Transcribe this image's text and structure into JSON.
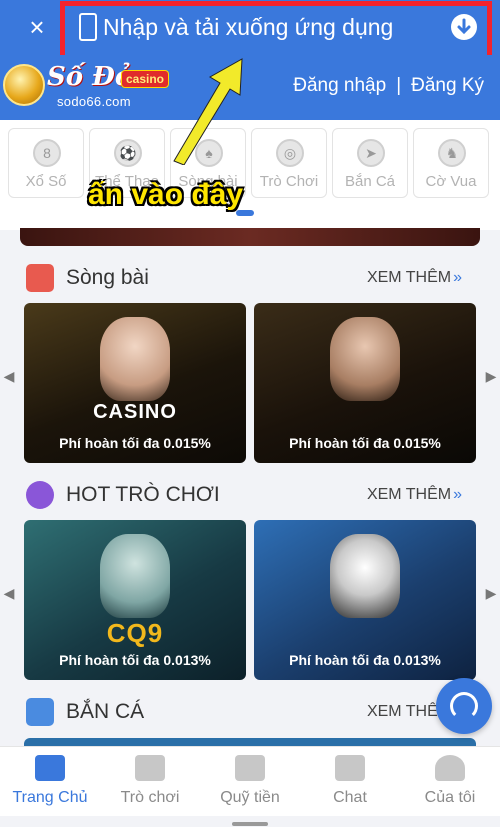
{
  "topbar": {
    "close": "×",
    "download_text": "Nhập và tải xuống ứng dụng"
  },
  "header": {
    "logo_name": "Số Đỏ",
    "logo_badge": "casino",
    "logo_url": "sodo66.com",
    "login": "Đăng nhập",
    "separator": "|",
    "register": "Đăng Ký"
  },
  "categories": [
    "Xổ Số",
    "Thể Thao",
    "Sòng bài",
    "Trò Chơi",
    "Bắn Cá",
    "Cờ Vua"
  ],
  "annotation": {
    "text": "ấn vào đây",
    "color": "#ffe600"
  },
  "sections": {
    "casino": {
      "title": "Sòng bài",
      "more": "XEM THÊM",
      "cards": [
        {
          "brand": "CASINO",
          "caption": "Phí hoàn tối đa 0.015%"
        },
        {
          "brand": "",
          "caption": "Phí hoàn tối đa 0.015%"
        }
      ]
    },
    "games": {
      "title": "HOT TRÒ CHƠI",
      "more": "XEM THÊM",
      "cards": [
        {
          "brand": "CQ9",
          "caption": "Phí hoàn tối đa 0.013%"
        },
        {
          "brand": "",
          "caption": "Phí hoàn tối đa 0.013%"
        }
      ]
    },
    "fishing": {
      "title": "BẮN CÁ",
      "more": "XEM THÊM"
    }
  },
  "bottom_nav": [
    {
      "label": "Trang Chủ",
      "icon": "home-icon",
      "active": true
    },
    {
      "label": "Trò chơi",
      "icon": "gamepad-icon",
      "active": false
    },
    {
      "label": "Quỹ tiền",
      "icon": "coins-icon",
      "active": false
    },
    {
      "label": "Chat",
      "icon": "chat-icon",
      "active": false
    },
    {
      "label": "Của tôi",
      "icon": "user-icon",
      "active": false
    }
  ],
  "colors": {
    "brand": "#3a78dc",
    "highlight_border": "#f3232d"
  }
}
